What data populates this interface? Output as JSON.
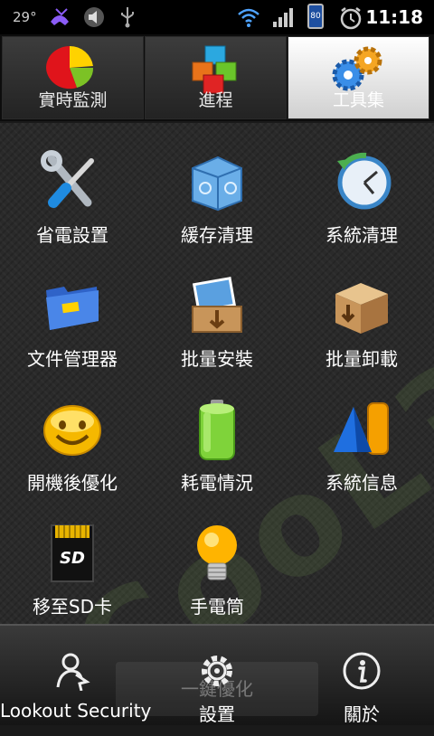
{
  "status_bar": {
    "temperature": "29°",
    "battery": "80",
    "time": "11:18"
  },
  "tabs": [
    {
      "label": "實時監測",
      "icon": "pie-chart-icon",
      "active": false
    },
    {
      "label": "進程",
      "icon": "cubes-icon",
      "active": false
    },
    {
      "label": "工具集",
      "icon": "gears-icon",
      "active": true
    }
  ],
  "watermark": "CooL3C",
  "tools": [
    {
      "label": "省電設置",
      "icon": "wrench-screwdriver-icon"
    },
    {
      "label": "緩存清理",
      "icon": "recycle-box-icon"
    },
    {
      "label": "系統清理",
      "icon": "clock-refresh-icon"
    },
    {
      "label": "文件管理器",
      "icon": "folder-icon"
    },
    {
      "label": "批量安裝",
      "icon": "install-box-icon"
    },
    {
      "label": "批量卸載",
      "icon": "uninstall-box-icon"
    },
    {
      "label": "開機後優化",
      "icon": "smiley-icon"
    },
    {
      "label": "耗電情況",
      "icon": "battery-icon"
    },
    {
      "label": "系統信息",
      "icon": "shapes-icon"
    },
    {
      "label": "移至SD卡",
      "icon": "sd-card-icon"
    },
    {
      "label": "手電筒",
      "icon": "light-bulb-icon"
    }
  ],
  "bottom_bar": {
    "ghost_label": "一鍵優化",
    "items": [
      {
        "label": "Lookout Security",
        "icon": "lookout-icon"
      },
      {
        "label": "設置",
        "icon": "gear-icon"
      },
      {
        "label": "關於",
        "icon": "info-icon"
      }
    ]
  }
}
